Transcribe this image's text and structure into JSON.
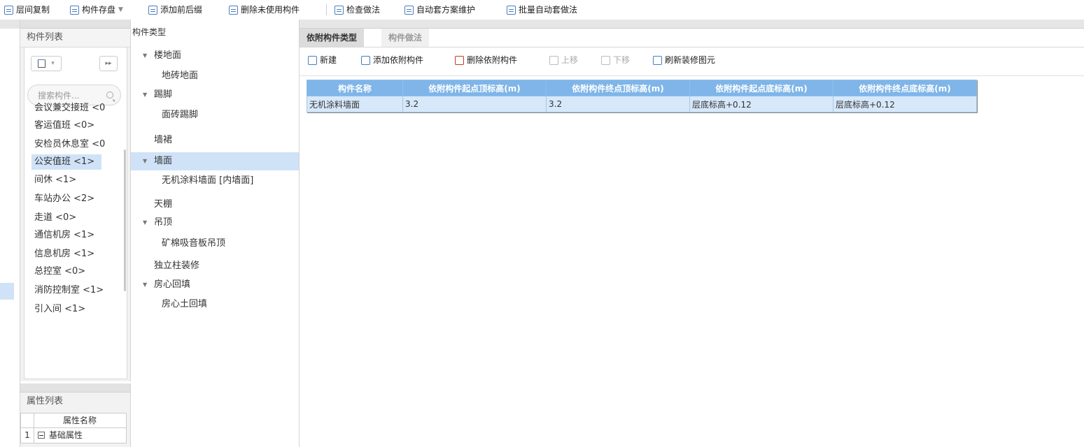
{
  "toolbar": {
    "items": [
      "层间复制",
      "构件存盘",
      "添加前后缀",
      "删除未使用构件",
      "检查做法",
      "自动套方案维护",
      "批量自动套做法"
    ]
  },
  "component_list": {
    "title": "构件列表",
    "search_placeholder": "搜索构件...",
    "items": [
      "会议兼交接班 <0",
      "客运值班 <0>",
      "安检员休息室 <0",
      "公安值班 <1>",
      "间休 <1>",
      "车站办公 <2>",
      "走道 <0>",
      "通信机房 <1>",
      "信息机房 <1>",
      "总控室 <0>",
      "消防控制室 <1>",
      "引入间 <1>"
    ],
    "selected_index": 3
  },
  "attribute_list": {
    "title": "属性列表",
    "header": "属性名称",
    "rows": [
      {
        "num": "1",
        "label": "基础属性"
      }
    ]
  },
  "type_tree": {
    "title": "构件类型",
    "nodes": [
      {
        "label": "楼地面",
        "level": 0,
        "expanded": true
      },
      {
        "label": "地砖地面",
        "level": 1
      },
      {
        "label": "踢脚",
        "level": 0,
        "expanded": true
      },
      {
        "label": "面砖踢脚",
        "level": 1
      },
      {
        "label": "墙裙",
        "level": 0
      },
      {
        "label": "墙面",
        "level": 0,
        "expanded": true,
        "selected": true
      },
      {
        "label": "无机涂料墙面 [内墙面]",
        "level": 1
      },
      {
        "label": "天棚",
        "level": 0
      },
      {
        "label": "吊顶",
        "level": 0,
        "expanded": true
      },
      {
        "label": "矿棉吸音板吊顶",
        "level": 1
      },
      {
        "label": "独立柱装修",
        "level": 0
      },
      {
        "label": "房心回填",
        "level": 0,
        "expanded": true
      },
      {
        "label": "房心土回填",
        "level": 1
      }
    ]
  },
  "right": {
    "tabs": [
      "依附构件类型",
      "构件做法"
    ],
    "active_tab": 0,
    "toolbar": [
      {
        "label": "新建",
        "enabled": true
      },
      {
        "label": "添加依附构件",
        "enabled": true
      },
      {
        "label": "删除依附构件",
        "enabled": true
      },
      {
        "label": "上移",
        "enabled": false
      },
      {
        "label": "下移",
        "enabled": false
      },
      {
        "label": "刷新装修图元",
        "enabled": true
      }
    ],
    "table": {
      "headers": [
        "构件名称",
        "依附构件起点顶标高(m)",
        "依附构件终点顶标高(m)",
        "依附构件起点底标高(m)",
        "依附构件终点底标高(m)"
      ],
      "rows": [
        [
          "无机涂料墙面",
          "3.2",
          "3.2",
          "层底标高+0.12",
          "层底标高+0.12"
        ]
      ]
    }
  },
  "colors": {
    "selection": "#cfe2f7",
    "header_blue": "#7fb5e8",
    "row_blue": "#d6e8f9",
    "accent_icon": "#4a7fc1"
  }
}
